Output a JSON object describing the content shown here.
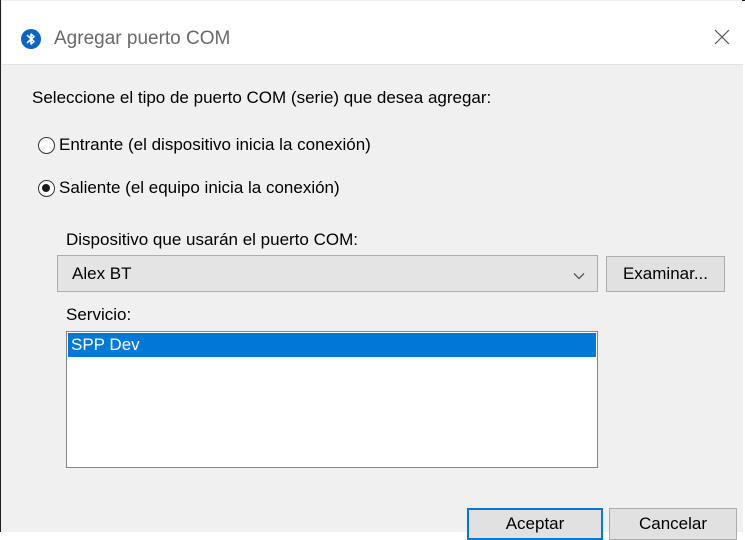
{
  "window": {
    "title": "Agregar puerto COM",
    "icon": "bluetooth-icon",
    "close_icon": "close-icon"
  },
  "prompt": "Seleccione el tipo de puerto COM (serie) que desea agregar:",
  "radios": {
    "incoming": {
      "label": "Entrante (el dispositivo inicia la conexión)",
      "checked": false
    },
    "outgoing": {
      "label": "Saliente (el equipo inicia la conexión)",
      "checked": true
    }
  },
  "device": {
    "label": "Dispositivo que usarán el puerto COM:",
    "value": "Alex BT",
    "browse_label": "Examinar..."
  },
  "service": {
    "label": "Servicio:",
    "items": [
      {
        "name": "SPP Dev",
        "selected": true
      }
    ]
  },
  "buttons": {
    "ok": "Aceptar",
    "cancel": "Cancelar"
  },
  "colors": {
    "accent": "#0078d7",
    "bluetooth": "#0a64c8",
    "dialog_bg": "#f0f0f0"
  }
}
